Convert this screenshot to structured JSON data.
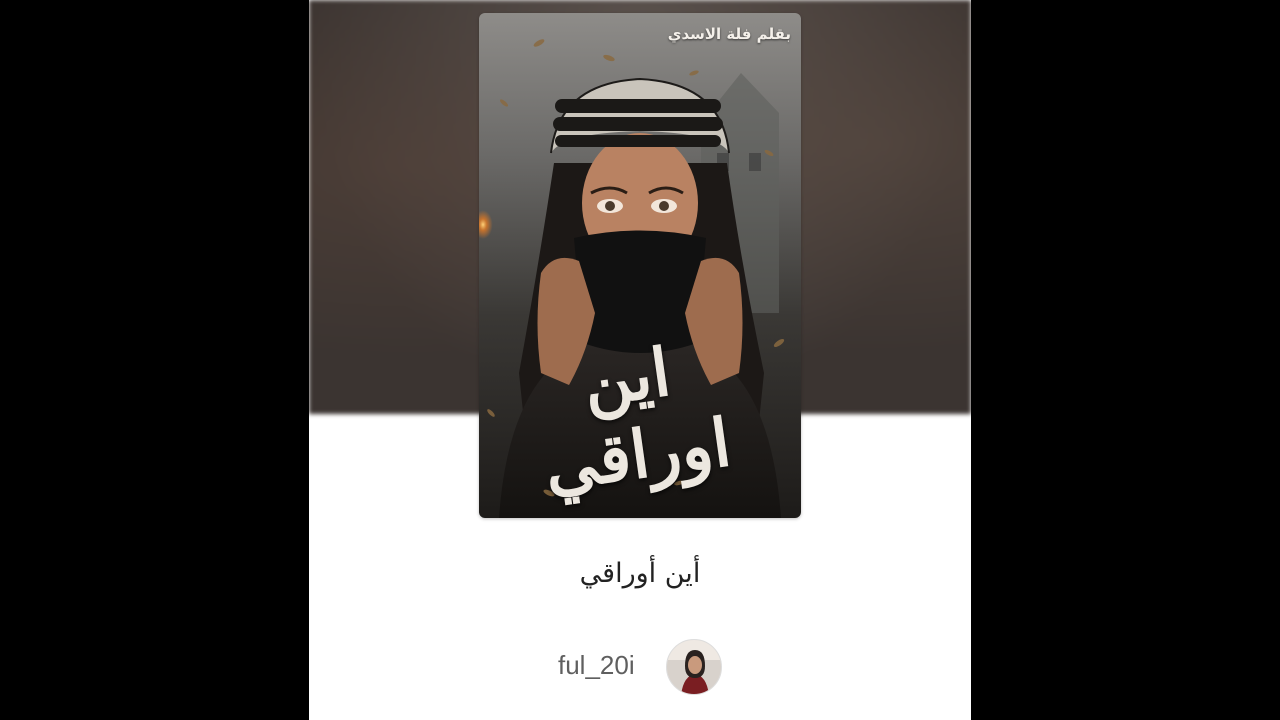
{
  "story": {
    "title": "أين أوراقي",
    "cover": {
      "author_line": "بقلم فلة الاسدي",
      "title_art": "اين اوراقي"
    }
  },
  "author": {
    "username": "ful_20i"
  },
  "colors": {
    "background": "#000000",
    "screen": "#ffffff",
    "backdrop": "#3b3431",
    "title_text": "#222222",
    "username_text": "#5f5f5f"
  },
  "icons": {
    "avatar": "user-avatar-photo"
  }
}
